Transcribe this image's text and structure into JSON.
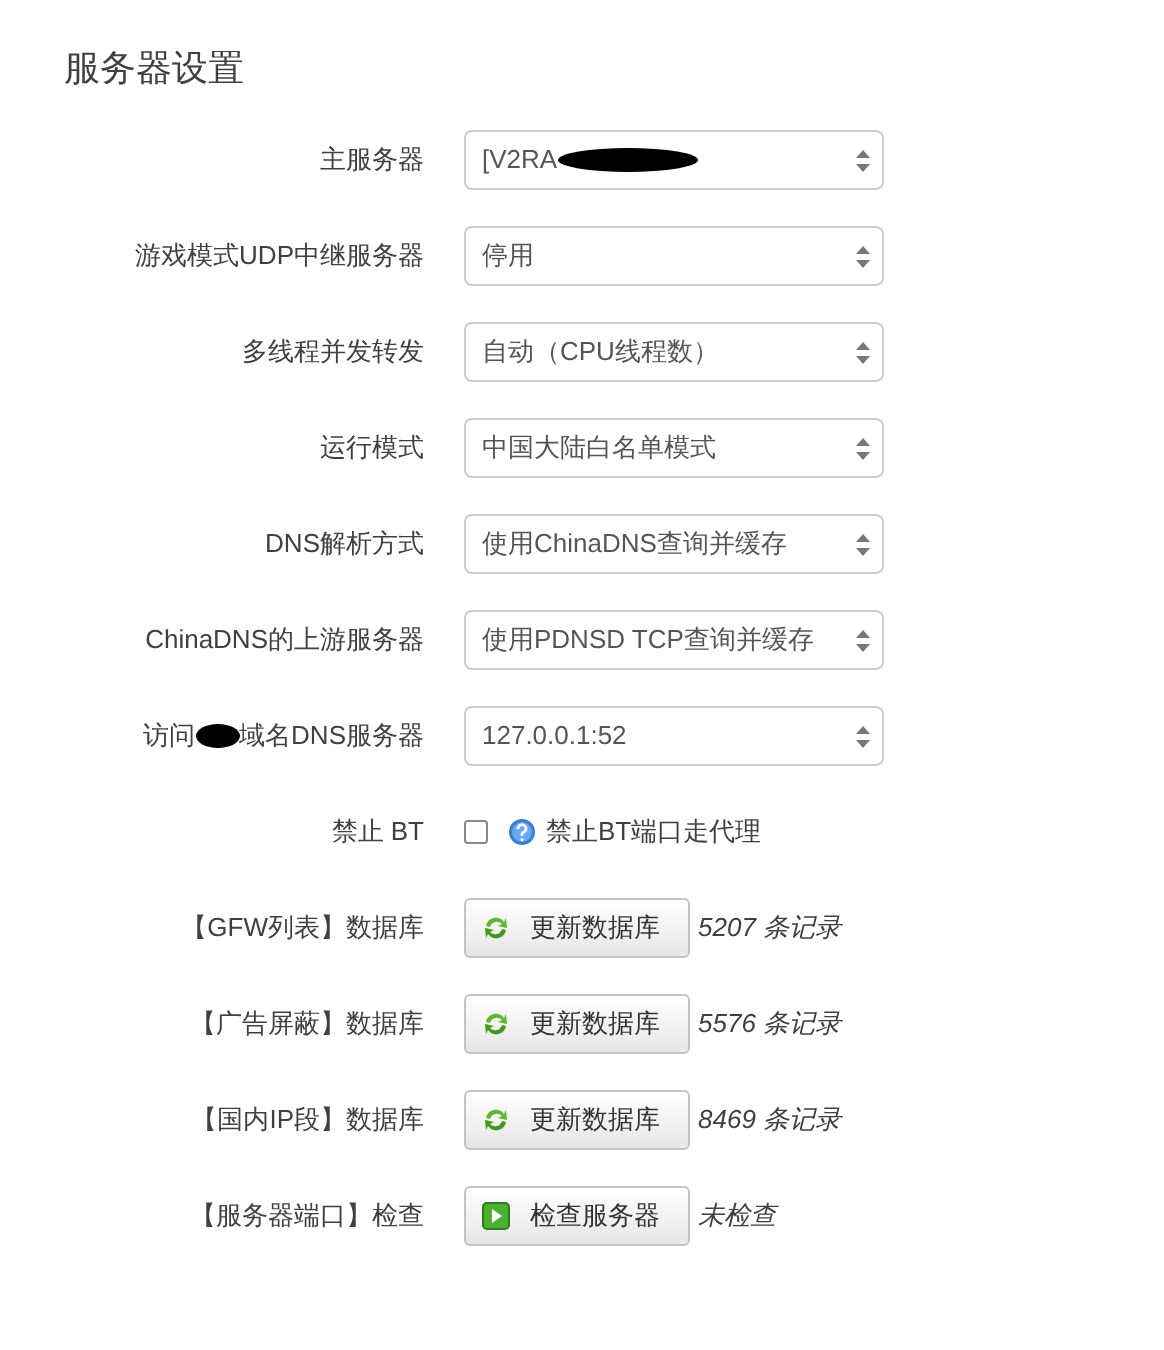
{
  "title": "服务器设置",
  "rows": [
    {
      "kind": "select",
      "label": "主服务器",
      "value": "[V2RA",
      "redacted": true
    },
    {
      "kind": "select",
      "label": "游戏模式UDP中继服务器",
      "value": "停用"
    },
    {
      "kind": "select",
      "label": "多线程并发转发",
      "value": "自动（CPU线程数）"
    },
    {
      "kind": "select",
      "label": "运行模式",
      "value": "中国大陆白名单模式"
    },
    {
      "kind": "select",
      "label": "DNS解析方式",
      "value": "使用ChinaDNS查询并缓存"
    },
    {
      "kind": "select",
      "label": "ChinaDNS的上游服务器",
      "value": "使用PDNSD TCP查询并缓存"
    },
    {
      "kind": "select",
      "label_parts": [
        "访问",
        "域名DNS服务器"
      ],
      "value": "127.0.0.1:52"
    },
    {
      "kind": "checkbox",
      "label": "禁止 BT",
      "checked": false,
      "hint": "禁止BT端口走代理"
    },
    {
      "kind": "update-button",
      "label": "【GFW列表】数据库",
      "button": "更新数据库",
      "note": "5207 条记录"
    },
    {
      "kind": "update-button",
      "label": "【广告屏蔽】数据库",
      "button": "更新数据库",
      "note": "5576 条记录"
    },
    {
      "kind": "update-button",
      "label": "【国内IP段】数据库",
      "button": "更新数据库",
      "note": "8469 条记录"
    },
    {
      "kind": "check-button",
      "label": "【服务器端口】检查",
      "button": "检查服务器",
      "note": "未检查"
    }
  ]
}
